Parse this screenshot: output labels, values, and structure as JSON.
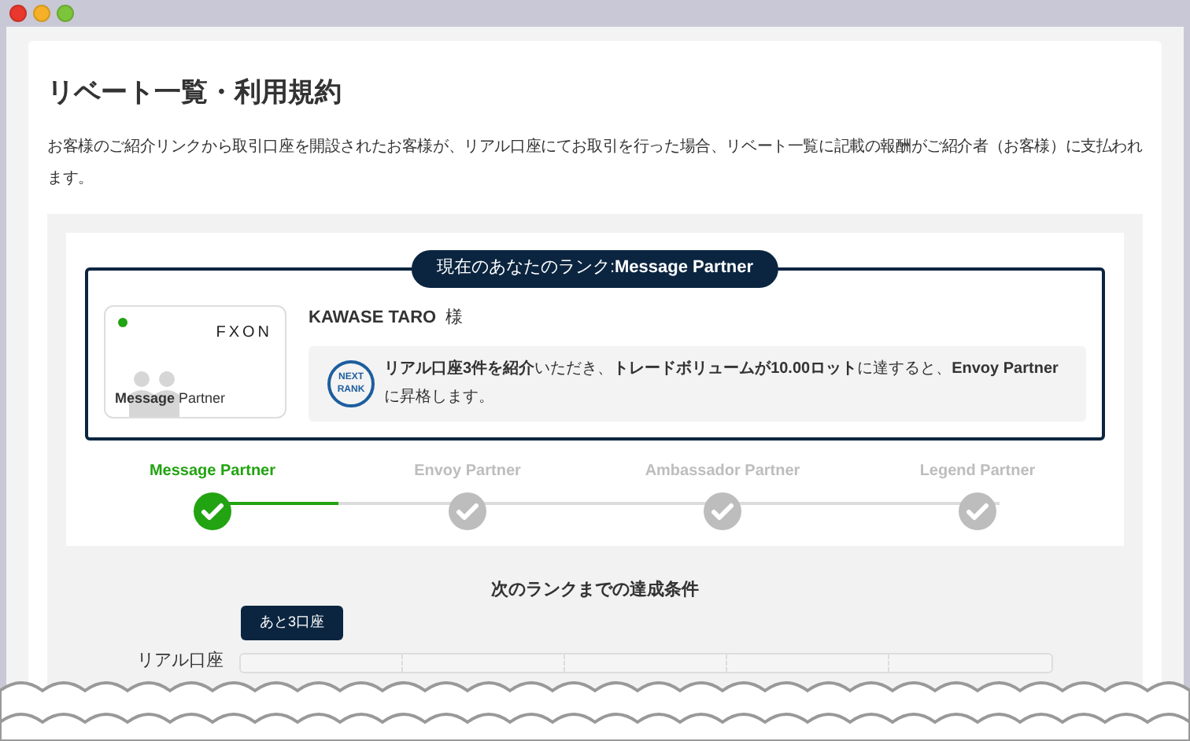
{
  "page": {
    "title": "リベート一覧・利用規約",
    "description": "お客様のご紹介リンクから取引口座を開設されたお客様が、リアル口座にてお取引を行った場合、リベート一覧に記載の報酬がご紹介者（お客様）に支払われます。"
  },
  "rank_box": {
    "heading": "現在のあなたのランク:**Message Partner**",
    "card": {
      "logo": "FXON",
      "caption": "**Message** Partner"
    },
    "user_name": "KAWASE TARO",
    "honorific": "様",
    "badge_lines": [
      "NEXT",
      "RANK"
    ],
    "message": "**リアル口座3件を紹介**いただき、**トレードボリュームが10.00ロット**に達すると、**Envoy Partner**に昇格します。"
  },
  "rank_steps": {
    "level": 0.16,
    "items": [
      {
        "label": "Message Partner",
        "selected": true
      },
      {
        "label": "Envoy Partner",
        "selected": false
      },
      {
        "label": "Ambassador Partner",
        "selected": false
      },
      {
        "label": "Legend Partner",
        "selected": false
      }
    ]
  },
  "conditions": {
    "title": "次のランクまでの達成条件",
    "rows": [
      {
        "label": "リアル口座",
        "tooltip": "あと3口座"
      }
    ]
  }
}
